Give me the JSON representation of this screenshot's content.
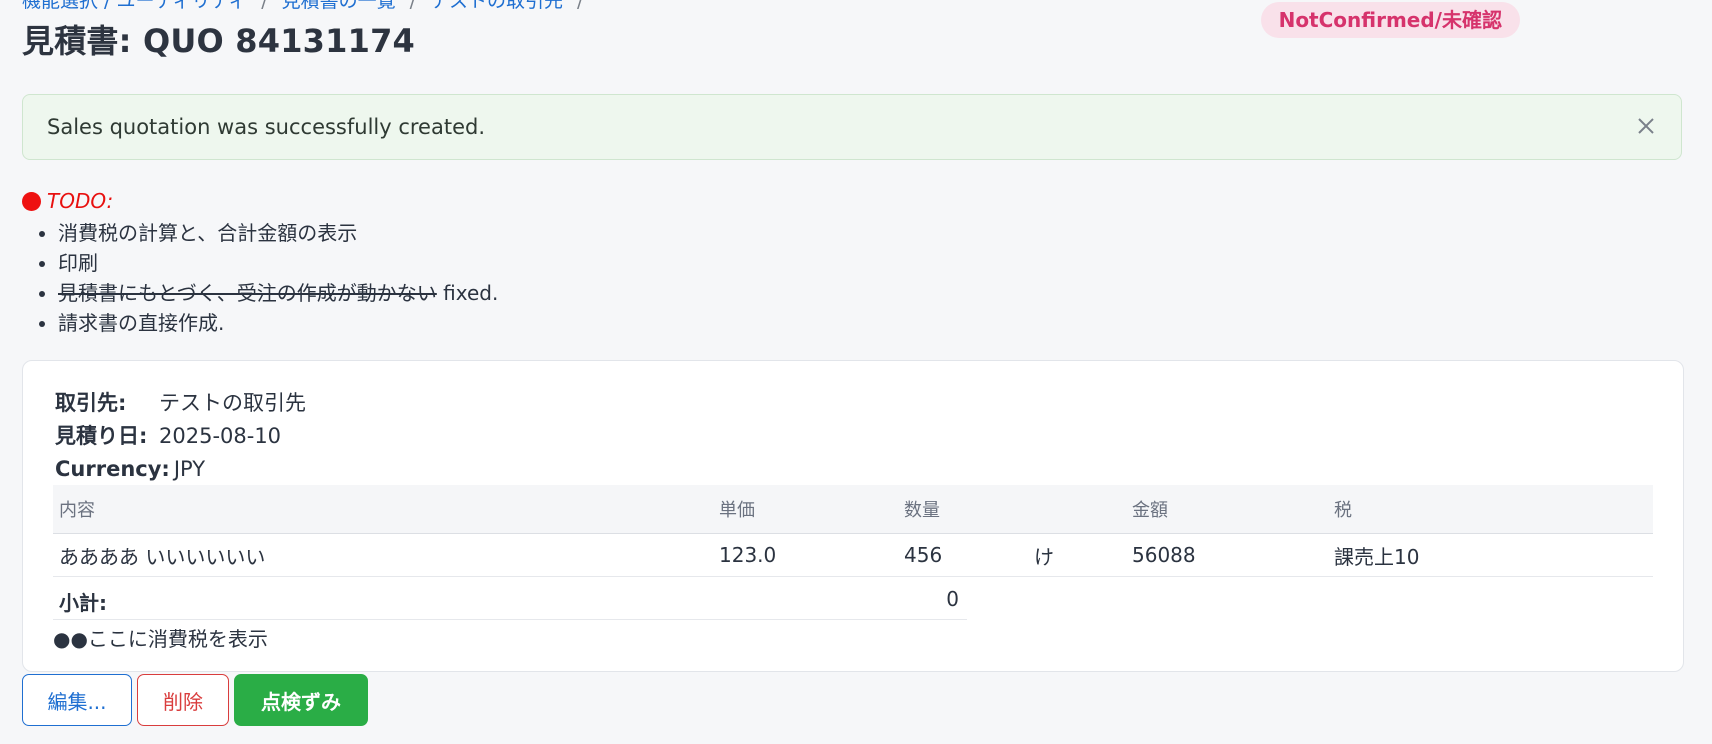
{
  "breadcrumb": {
    "items": [
      "機能選択 / ユーティリティ",
      "見積書の一覧",
      "テストの取引先"
    ],
    "separator": "/"
  },
  "page": {
    "title": "見積書: QUO 84131174"
  },
  "status_badge": {
    "label": "NotConfirmed/未確認",
    "color": "#d6336c",
    "background": "#f9e1ea"
  },
  "alert": {
    "message": "Sales quotation was successfully created.",
    "close_icon": "close-icon"
  },
  "todo": {
    "heading": "TODO:",
    "items": [
      {
        "text": "消費税の計算と、合計金額の表示",
        "suffix": ""
      },
      {
        "text": "印刷",
        "suffix": ""
      },
      {
        "text": "見積書にもとづく、受注の作成が動かない",
        "suffix": " fixed.",
        "struck": true
      },
      {
        "text": "請求書の直接作成.",
        "suffix": ""
      }
    ]
  },
  "quotation": {
    "customer_label": "取引先:",
    "customer": "テストの取引先",
    "date_label": "見積り日:",
    "date": "2025-08-10",
    "currency_label": "Currency:",
    "currency": "JPY"
  },
  "items_table": {
    "headers": [
      "内容",
      "単価",
      "数量",
      "",
      "金額",
      "税"
    ],
    "rows": [
      [
        "ああああ いいいいいい",
        "123.0",
        "456",
        "け",
        "56088",
        "課売上10"
      ]
    ]
  },
  "subtotal": {
    "label": "小計:",
    "value": "0"
  },
  "tax_note": "●●ここに消費税を表示",
  "actions": {
    "edit": "編集...",
    "delete": "削除",
    "check": "点検ずみ"
  },
  "colors": {
    "primary": "#1f6fd1",
    "danger": "#d93d3d",
    "success": "#2aad46",
    "todo_red": "#ee1111"
  }
}
